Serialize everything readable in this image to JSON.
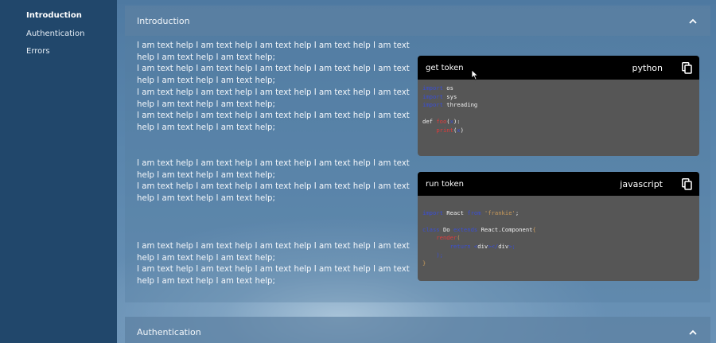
{
  "sidebar": {
    "items": [
      {
        "label": "Introduction"
      },
      {
        "label": "Authentication"
      },
      {
        "label": "Errors"
      }
    ]
  },
  "sections": {
    "introduction": {
      "title": "Introduction",
      "paragraphs": [
        [
          "I am text help I am text help I am text help I am text help I am text help I am text help I am text help;",
          "I am text help I am text help I am text help I am text help I am text help I am text help I am text help;",
          "I am text help I am text help I am text help I am text help I am text help I am text help I am text help;",
          "I am text help I am text help I am text help I am text help I am text help I am text help I am text help;"
        ],
        [
          "I am text help I am text help I am text help I am text help I am text help I am text help I am text help;",
          "I am text help I am text help I am text help I am text help I am text help I am text help I am text help;"
        ],
        [
          "I am text help I am text help I am text help I am text help I am text help I am text help I am text help;",
          "I am text help I am text help I am text help I am text help I am text help I am text help I am text help;"
        ]
      ],
      "code_samples": [
        {
          "title": "get token",
          "language": "python",
          "lines": [
            [
              {
                "t": "import",
                "c": "kw"
              },
              {
                "t": " os",
                "c": "plain"
              }
            ],
            [
              {
                "t": "import",
                "c": "kw"
              },
              {
                "t": " sys",
                "c": "plain"
              }
            ],
            [
              {
                "t": "import",
                "c": "kw"
              },
              {
                "t": " threading",
                "c": "plain"
              }
            ],
            [],
            [
              {
                "t": "def ",
                "c": "plain"
              },
              {
                "t": "foo",
                "c": "fn"
              },
              {
                "t": "(",
                "c": "plain"
              },
              {
                "t": "x",
                "c": "kw"
              },
              {
                "t": "):",
                "c": "plain"
              }
            ],
            [
              {
                "t": "    ",
                "c": "plain"
              },
              {
                "t": "print",
                "c": "fn"
              },
              {
                "t": "(",
                "c": "plain"
              },
              {
                "t": "x",
                "c": "kw"
              },
              {
                "t": ")",
                "c": "plain"
              }
            ]
          ]
        },
        {
          "title": "run token",
          "language": "javascript",
          "lines": [
            [],
            [
              {
                "t": "import",
                "c": "kw"
              },
              {
                "t": " React ",
                "c": "plain"
              },
              {
                "t": "from",
                "c": "kw"
              },
              {
                "t": " 'frankie'",
                "c": "str"
              },
              {
                "t": ";",
                "c": "plain"
              }
            ],
            [],
            [
              {
                "t": "class",
                "c": "kw"
              },
              {
                "t": " Do ",
                "c": "plain"
              },
              {
                "t": "extends",
                "c": "kw"
              },
              {
                "t": " React.Component",
                "c": "plain"
              },
              {
                "t": "{",
                "c": "str"
              }
            ],
            [
              {
                "t": "    ",
                "c": "plain"
              },
              {
                "t": "render",
                "c": "fn"
              },
              {
                "t": "(",
                "c": "str"
              }
            ],
            [
              {
                "t": "        ",
                "c": "plain"
              },
              {
                "t": "return",
                "c": "kw"
              },
              {
                "t": " <",
                "c": "kw"
              },
              {
                "t": "div",
                "c": "plain"
              },
              {
                "t": "></",
                "c": "kw"
              },
              {
                "t": "div",
                "c": "plain"
              },
              {
                "t": ">;",
                "c": "kw"
              }
            ],
            [
              {
                "t": "    ",
                "c": "plain"
              },
              {
                "t": ");",
                "c": "kw"
              }
            ],
            [
              {
                "t": "}",
                "c": "str"
              }
            ]
          ]
        }
      ]
    },
    "authentication": {
      "title": "Authentication"
    }
  },
  "icons": {
    "collapse": "chevron-up-icon",
    "copy": "copy-icon"
  },
  "colors": {
    "sidebar_bg": "#21476b",
    "code_header_bg": "#000000",
    "code_body_bg": "#565656",
    "keyword": "#3a4fd6",
    "function": "#e03a3a",
    "string": "#c99a5a"
  }
}
